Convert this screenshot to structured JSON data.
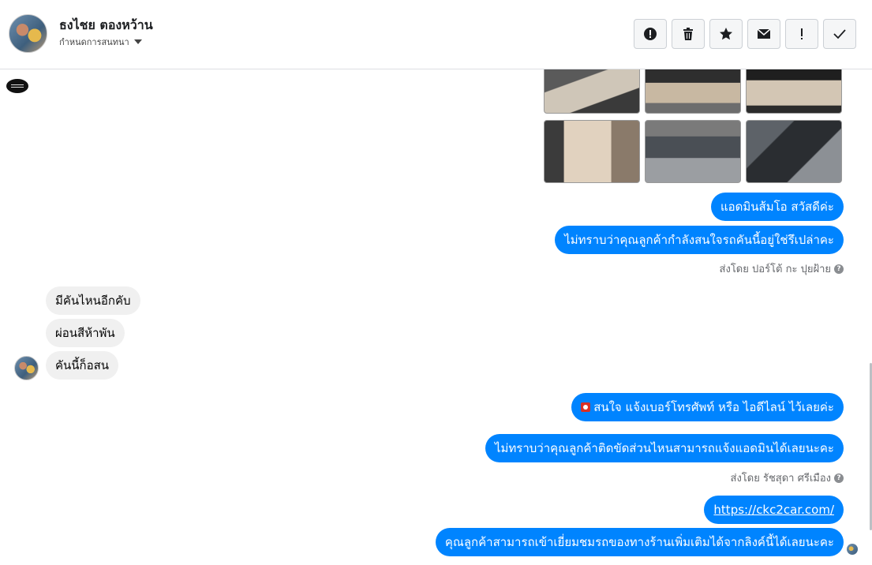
{
  "header": {
    "contact_name": "ธงไชย ตองหว้าน",
    "subtitle": "กำหนดการสนทนา",
    "actions": [
      {
        "icon": "alert-circle-icon",
        "label": "mark-spam"
      },
      {
        "icon": "trash-icon",
        "label": "delete"
      },
      {
        "icon": "star-icon",
        "label": "star"
      },
      {
        "icon": "envelope-icon",
        "label": "mark-unread"
      },
      {
        "icon": "exclamation-icon",
        "label": "flag"
      },
      {
        "icon": "check-icon",
        "label": "mark-done"
      }
    ]
  },
  "messages": {
    "out1": "แอดมินส้มโอ สวัสดีค่ะ",
    "out2": "ไม่ทราบว่าคุณลูกค้ากำลังสนใจรถคันนี้อยู่ใช่รึเปล่าคะ",
    "sent_by1": "ส่งโดย ปอร์โต้ กะ ปุยฝ้าย",
    "in1": "มีคันไหนอีกคับ",
    "in2": "ผ่อนสีห้าพัน",
    "in3": "คันนี้ก็อสน",
    "out3": "สนใจ แจ้งเบอร์โทรศัพท์ หรือ ไอดีไลน์  ไว้เลยค่ะ",
    "out4": "ไม่ทราบว่าคุณลูกค้าติดขัดส่วนไหนสามารถแจ้งแอดมินได้เลยนะคะ",
    "sent_by2": "ส่งโดย รัชสุดา ศรีเมือง",
    "out5": "https://ckc2car.com/",
    "out6": "คุณลูกค้าสามารถเข้าเยี่ยมชมรถของทางร้านเพิ่มเติมได้จากลิงค์นี้ได้เลยนะคะ"
  },
  "colors": {
    "outgoing_bubble": "#0084ff",
    "incoming_bubble": "#f0f0f0"
  }
}
